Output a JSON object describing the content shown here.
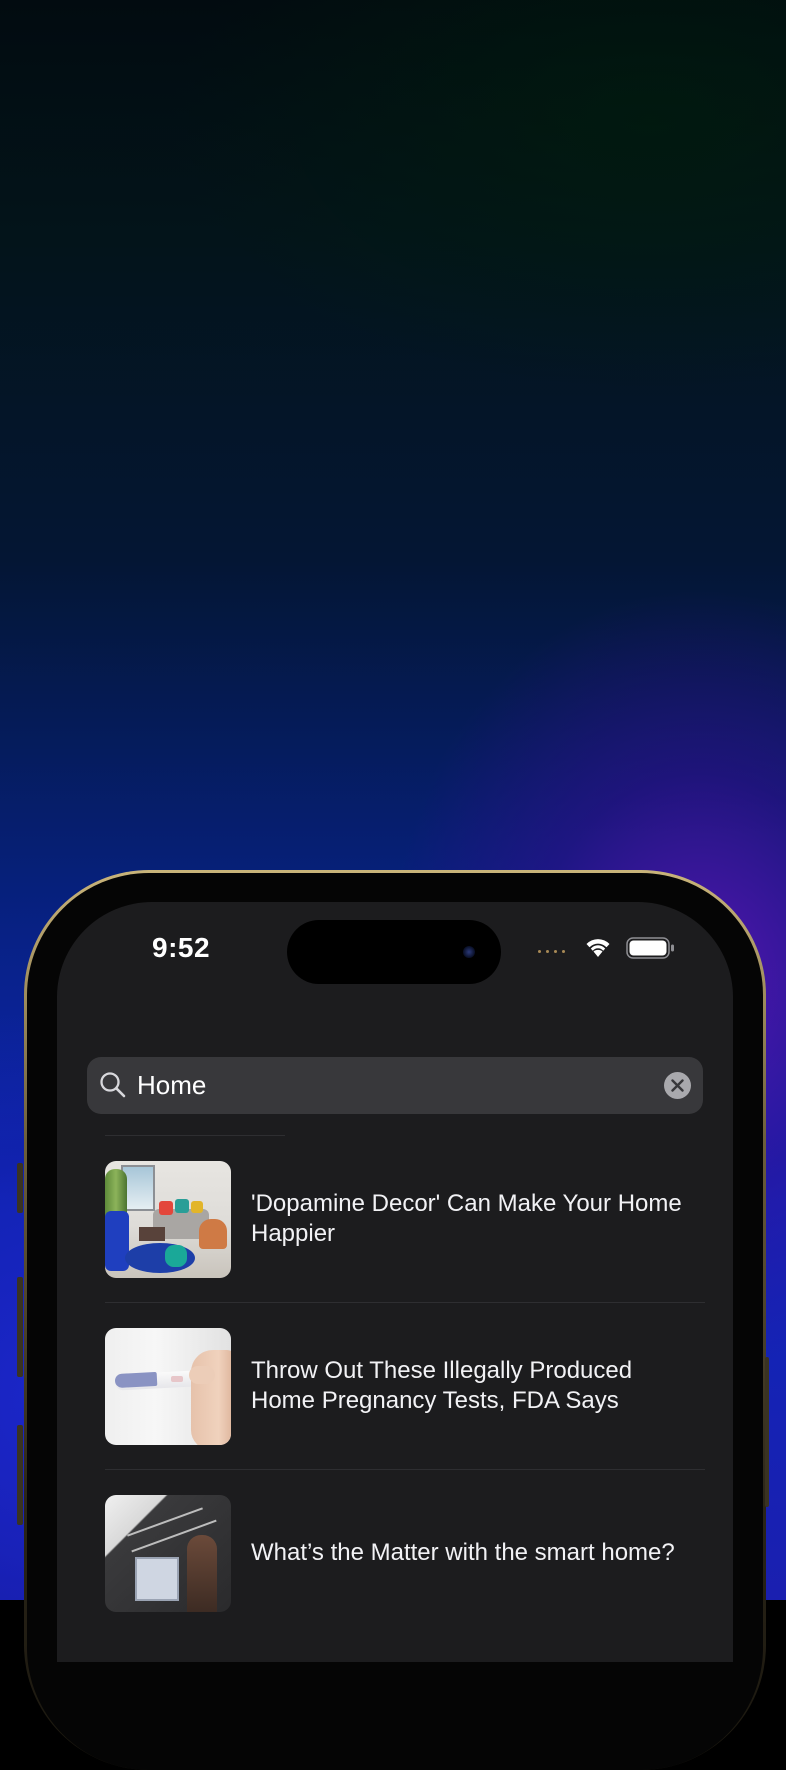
{
  "status_bar": {
    "time": "9:52",
    "wifi_icon": "wifi-icon",
    "battery_icon": "battery-full-icon"
  },
  "search": {
    "value": "Home",
    "icon": "search-icon",
    "clear_icon": "clear-circle-icon"
  },
  "results": [
    {
      "title": "'Dopamine Decor' Can Make Your Home Happier",
      "thumbnail": "living-room-photo"
    },
    {
      "title": "Throw Out These Illegally Produced Home Pregnancy Tests, FDA Says",
      "thumbnail": "pregnancy-test-photo"
    },
    {
      "title": "What’s the Matter with the smart home?",
      "thumbnail": "smart-home-photo"
    }
  ],
  "colors": {
    "screen_background": "#1c1c1e",
    "search_field": "#38383b",
    "text_primary": "#f2f2f5",
    "frame_gold": "#c9b47a"
  }
}
